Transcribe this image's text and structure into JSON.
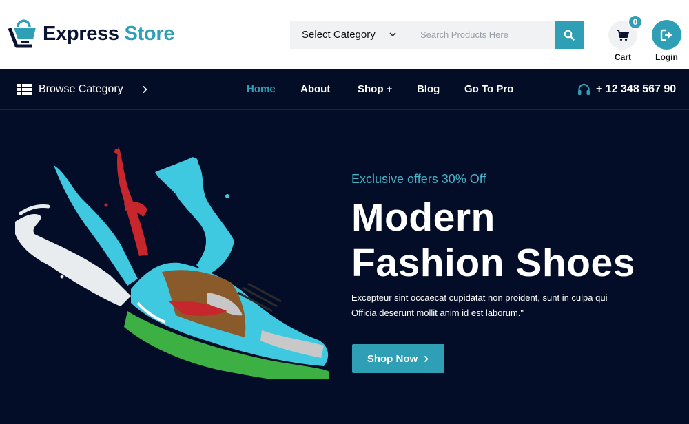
{
  "brand": {
    "name_part1": "Express",
    "name_part2": "Store",
    "primary_color": "#0a1330",
    "accent_color": "#2f9fb6"
  },
  "search": {
    "category_label": "Select Category",
    "placeholder": "Search Products Here",
    "button_icon": "search-icon"
  },
  "cart": {
    "label": "Cart",
    "count": "0",
    "icon": "cart-icon"
  },
  "login": {
    "label": "Login",
    "icon": "sign-in-icon"
  },
  "nav": {
    "browse_label": "Browse Category",
    "items": [
      {
        "label": "Home",
        "active": true
      },
      {
        "label": "About",
        "active": false
      },
      {
        "label": "Shop +",
        "active": false
      },
      {
        "label": "Blog",
        "active": false
      },
      {
        "label": "Go To Pro",
        "active": false
      }
    ],
    "phone": "+ 12 348 567 90",
    "background": "#040d26"
  },
  "hero": {
    "kicker": "Exclusive offers 30% Off",
    "title_line1": "Modern",
    "title_line2": "Fashion Shoes",
    "description": "Excepteur sint occaecat cupidatat non proident, sunt in culpa qui Officia deserunt mollit anim id est laborum.\"",
    "cta_label": "Shop Now",
    "background": "#030d27"
  }
}
